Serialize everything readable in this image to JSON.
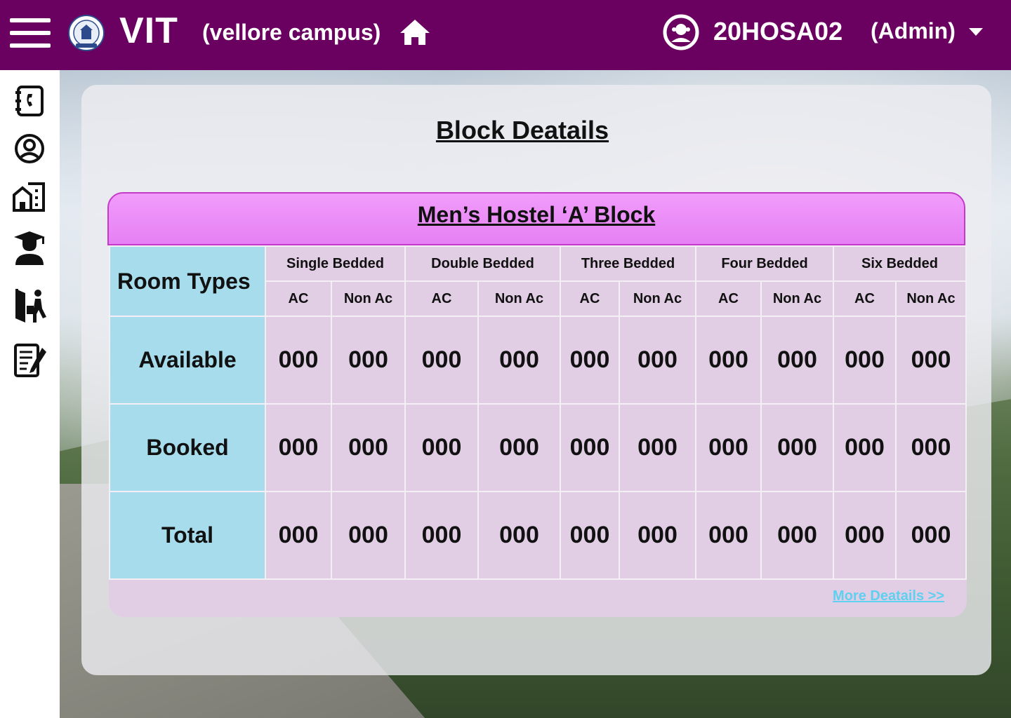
{
  "header": {
    "brand": "VIT",
    "campus": "(vellore campus)",
    "user_id": "20HOSA02",
    "user_role": "(Admin)"
  },
  "sidebar": {
    "items": [
      {
        "icon": "contacts-book-icon"
      },
      {
        "icon": "user-profile-icon"
      },
      {
        "icon": "buildings-icon"
      },
      {
        "icon": "student-graduate-icon"
      },
      {
        "icon": "checkout-exit-icon"
      },
      {
        "icon": "form-edit-icon"
      }
    ]
  },
  "page": {
    "title": "Block Deatails"
  },
  "block": {
    "title": "Men’s Hostel ‘A’ Block",
    "row_header": "Room Types",
    "room_types": [
      "Single Bedded",
      "Double Bedded",
      "Three Bedded",
      "Four Bedded",
      "Six Bedded"
    ],
    "sub_headers": [
      "AC",
      "Non Ac"
    ],
    "rows": [
      {
        "label": "Available",
        "values": [
          "000",
          "000",
          "000",
          "000",
          "000",
          "000",
          "000",
          "000",
          "000",
          "000"
        ]
      },
      {
        "label": "Booked",
        "values": [
          "000",
          "000",
          "000",
          "000",
          "000",
          "000",
          "000",
          "000",
          "000",
          "000"
        ]
      },
      {
        "label": "Total",
        "values": [
          "000",
          "000",
          "000",
          "000",
          "000",
          "000",
          "000",
          "000",
          "000",
          "000"
        ]
      }
    ],
    "more_link": "More Deatails >>"
  },
  "colors": {
    "topbar": "#6a0060",
    "panel_head": "#f19cfb",
    "panel_body": "#e1cde4",
    "label_cell": "#a6dcec",
    "link": "#5fd0f0"
  }
}
